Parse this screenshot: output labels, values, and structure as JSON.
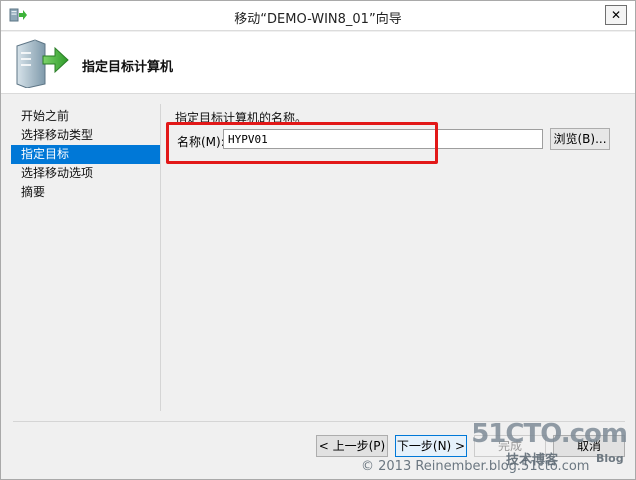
{
  "titlebar": {
    "title": "移动“DEMO-WIN8_01”向导",
    "close_glyph": "✕"
  },
  "header": {
    "title": "指定目标计算机"
  },
  "nav": {
    "items": [
      {
        "label": "开始之前",
        "active": false
      },
      {
        "label": "选择移动类型",
        "active": false
      },
      {
        "label": "指定目标",
        "active": true
      },
      {
        "label": "选择移动选项",
        "active": false
      },
      {
        "label": "摘要",
        "active": false
      }
    ]
  },
  "content": {
    "heading": "指定目标计算机的名称。",
    "name_label": "名称(M):",
    "name_value": "HYPV01",
    "browse_label": "浏览(B)..."
  },
  "footer": {
    "prev_label": "< 上一步(P)",
    "next_label": "下一步(N) >",
    "finish_label": "完成",
    "cancel_label": "取消"
  },
  "watermark": {
    "logo": "51CTO.com",
    "sub": "技术博客",
    "blog": "Blog",
    "copyright": "© 2013 Reinember.blog.51cto.com"
  },
  "colors": {
    "accent": "#0078d7",
    "highlight": "#e21818"
  }
}
